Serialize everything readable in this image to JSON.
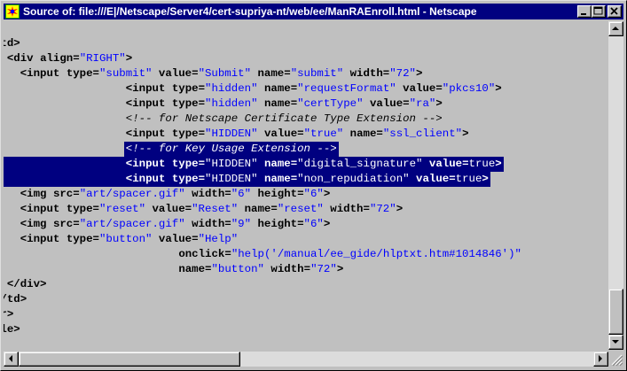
{
  "window": {
    "title": "Source of: file:///E|/Netscape/Server4/cert-supriya-nt/web/ee/ManRAEnroll.html - Netscape"
  },
  "icons": {
    "app": "netscape-app-icon",
    "minimize": "minimize-icon",
    "maximize": "maximize-icon",
    "close": "close-icon",
    "scroll_up": "arrow-up-icon",
    "scroll_down": "arrow-down-icon",
    "scroll_left": "arrow-left-icon",
    "scroll_right": "arrow-right-icon",
    "size_grip": "size-grip-icon"
  },
  "colors": {
    "titlebar": "#000080",
    "selection": "#000080",
    "attribute_value": "#0000ff",
    "background": "#c0c0c0"
  },
  "source_lines": [
    {
      "indent": 0,
      "tokens": [
        {
          "t": ">",
          "c": "punct"
        }
      ]
    },
    {
      "indent": 0,
      "tokens": [
        {
          "t": "<td>",
          "c": "tag"
        }
      ]
    },
    {
      "indent": 2,
      "tokens": [
        {
          "t": "<div ",
          "c": "tag"
        },
        {
          "t": "align=",
          "c": "attr"
        },
        {
          "t": "\"RIGHT\"",
          "c": "val"
        },
        {
          "t": ">",
          "c": "punct"
        }
      ]
    },
    {
      "indent": 4,
      "tokens": [
        {
          "t": "<input ",
          "c": "tag"
        },
        {
          "t": "type=",
          "c": "attr"
        },
        {
          "t": "\"submit\"",
          "c": "val"
        },
        {
          "t": " value=",
          "c": "attr"
        },
        {
          "t": "\"Submit\"",
          "c": "val"
        },
        {
          "t": " name=",
          "c": "attr"
        },
        {
          "t": "\"submit\"",
          "c": "val"
        },
        {
          "t": " width=",
          "c": "attr"
        },
        {
          "t": "\"72\"",
          "c": "val"
        },
        {
          "t": ">",
          "c": "punct"
        }
      ]
    },
    {
      "indent": 20,
      "tokens": [
        {
          "t": "<input ",
          "c": "tag"
        },
        {
          "t": "type=",
          "c": "attr"
        },
        {
          "t": "\"hidden\"",
          "c": "val"
        },
        {
          "t": " name=",
          "c": "attr"
        },
        {
          "t": "\"requestFormat\"",
          "c": "val"
        },
        {
          "t": " value=",
          "c": "attr"
        },
        {
          "t": "\"pkcs10\"",
          "c": "val"
        },
        {
          "t": ">",
          "c": "punct"
        }
      ]
    },
    {
      "indent": 20,
      "tokens": [
        {
          "t": "<input ",
          "c": "tag"
        },
        {
          "t": "type=",
          "c": "attr"
        },
        {
          "t": "\"hidden\"",
          "c": "val"
        },
        {
          "t": " name=",
          "c": "attr"
        },
        {
          "t": "\"certType\"",
          "c": "val"
        },
        {
          "t": " value=",
          "c": "attr"
        },
        {
          "t": "\"ra\"",
          "c": "val"
        },
        {
          "t": ">",
          "c": "punct"
        }
      ]
    },
    {
      "indent": 20,
      "tokens": [
        {
          "t": "<!-- for Netscape Certificate Type Extension -->",
          "c": "comment"
        }
      ]
    },
    {
      "indent": 20,
      "tokens": [
        {
          "t": "<input ",
          "c": "tag"
        },
        {
          "t": "type=",
          "c": "attr"
        },
        {
          "t": "\"HIDDEN\"",
          "c": "val"
        },
        {
          "t": " value=",
          "c": "attr"
        },
        {
          "t": "\"true\"",
          "c": "val"
        },
        {
          "t": " name=",
          "c": "attr"
        },
        {
          "t": "\"ssl_client\"",
          "c": "val"
        },
        {
          "t": ">",
          "c": "punct"
        }
      ]
    },
    {
      "indent": 20,
      "sel": "text",
      "tokens": [
        {
          "t": "<!-- for Key Usage Extension -->",
          "c": "comment"
        }
      ]
    },
    {
      "indent": 20,
      "sel": "full",
      "tokens": [
        {
          "t": "<input ",
          "c": "tag"
        },
        {
          "t": "type=",
          "c": "attr"
        },
        {
          "t": "\"HIDDEN\"",
          "c": "val"
        },
        {
          "t": " name=",
          "c": "attr"
        },
        {
          "t": "\"digital_signature\"",
          "c": "val"
        },
        {
          "t": " value=",
          "c": "attr"
        },
        {
          "t": "true",
          "c": "plain"
        },
        {
          "t": ">",
          "c": "punct"
        }
      ]
    },
    {
      "indent": 20,
      "sel": "full",
      "tokens": [
        {
          "t": "<input ",
          "c": "tag"
        },
        {
          "t": "type=",
          "c": "attr"
        },
        {
          "t": "\"HIDDEN\"",
          "c": "val"
        },
        {
          "t": " name=",
          "c": "attr"
        },
        {
          "t": "\"non_repudiation\"",
          "c": "val"
        },
        {
          "t": " value=",
          "c": "attr"
        },
        {
          "t": "true",
          "c": "plain"
        },
        {
          "t": ">",
          "c": "punct"
        }
      ]
    },
    {
      "indent": 4,
      "tokens": [
        {
          "t": "<img ",
          "c": "tag"
        },
        {
          "t": "src=",
          "c": "attr"
        },
        {
          "t": "\"art/spacer.gif\"",
          "c": "val"
        },
        {
          "t": " width=",
          "c": "attr"
        },
        {
          "t": "\"6\"",
          "c": "val"
        },
        {
          "t": " height=",
          "c": "attr"
        },
        {
          "t": "\"6\"",
          "c": "val"
        },
        {
          "t": ">",
          "c": "punct"
        }
      ]
    },
    {
      "indent": 4,
      "tokens": [
        {
          "t": "<input ",
          "c": "tag"
        },
        {
          "t": "type=",
          "c": "attr"
        },
        {
          "t": "\"reset\"",
          "c": "val"
        },
        {
          "t": " value=",
          "c": "attr"
        },
        {
          "t": "\"Reset\"",
          "c": "val"
        },
        {
          "t": " name=",
          "c": "attr"
        },
        {
          "t": "\"reset\"",
          "c": "val"
        },
        {
          "t": " width=",
          "c": "attr"
        },
        {
          "t": "\"72\"",
          "c": "val"
        },
        {
          "t": ">",
          "c": "punct"
        }
      ]
    },
    {
      "indent": 4,
      "tokens": [
        {
          "t": "<img ",
          "c": "tag"
        },
        {
          "t": "src=",
          "c": "attr"
        },
        {
          "t": "\"art/spacer.gif\"",
          "c": "val"
        },
        {
          "t": " width=",
          "c": "attr"
        },
        {
          "t": "\"9\"",
          "c": "val"
        },
        {
          "t": " height=",
          "c": "attr"
        },
        {
          "t": "\"6\"",
          "c": "val"
        },
        {
          "t": ">",
          "c": "punct"
        }
      ]
    },
    {
      "indent": 4,
      "tokens": [
        {
          "t": "<input ",
          "c": "tag"
        },
        {
          "t": "type=",
          "c": "attr"
        },
        {
          "t": "\"button\"",
          "c": "val"
        },
        {
          "t": " value=",
          "c": "attr"
        },
        {
          "t": "\"Help\"",
          "c": "val"
        }
      ]
    },
    {
      "indent": 28,
      "tokens": [
        {
          "t": "onclick=",
          "c": "attr"
        },
        {
          "t": "\"help('/manual/ee_gide/hlptxt.htm#1014846')\"",
          "c": "val"
        }
      ]
    },
    {
      "indent": 28,
      "tokens": [
        {
          "t": "name=",
          "c": "attr"
        },
        {
          "t": "\"button\"",
          "c": "val"
        },
        {
          "t": " width=",
          "c": "attr"
        },
        {
          "t": "\"72\"",
          "c": "val"
        },
        {
          "t": ">",
          "c": "punct"
        }
      ]
    },
    {
      "indent": 2,
      "tokens": [
        {
          "t": "</div>",
          "c": "tag"
        }
      ]
    },
    {
      "indent": 0,
      "tokens": [
        {
          "t": "</td>",
          "c": "tag"
        }
      ]
    },
    {
      "indent": 0,
      "tokens": [
        {
          "t": "tr>",
          "c": "tag"
        }
      ]
    },
    {
      "indent": 0,
      "tokens": [
        {
          "t": "ble>",
          "c": "tag"
        }
      ]
    }
  ]
}
